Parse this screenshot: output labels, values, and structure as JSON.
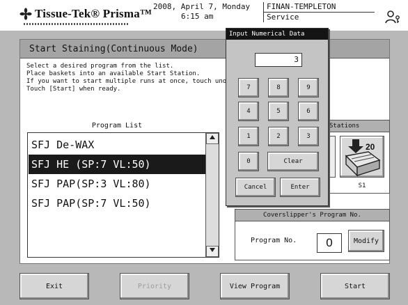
{
  "header": {
    "brand": "Tissue-Tek® Prisma™",
    "date": "2008, April 7, Monday",
    "time": "6:15 am",
    "user": "FINAN-TEMPLETON",
    "role": "Service",
    "icons": {
      "logo": "flower-logo-icon",
      "user": "user-key-icon"
    }
  },
  "screen": {
    "title": "Start Staining(Continuous Mode)",
    "instructions": [
      "Select a desired program from the list.",
      "Place baskets into an available Start Station.",
      "If you want to start multiple runs at once, touch unoccu",
      "Touch [Start] when ready."
    ]
  },
  "program_list": {
    "label": "Program List",
    "items": [
      "SFJ De-WAX",
      "SFJ HE (SP:7  VL:50)",
      "SFJ PAP(SP:3  VL:80)",
      "SFJ PAP(SP:7  VL:50)"
    ],
    "selected_index": 1
  },
  "stations": {
    "header": "Stations",
    "badge": "20",
    "station_label": "S1"
  },
  "coverslipper": {
    "header": "Coverslipper's  Program  No.",
    "label": "Program No.",
    "value": "0",
    "modify": "Modify"
  },
  "bottom_buttons": {
    "exit": "Exit",
    "priority": "Priority",
    "view_program": "View Program",
    "start": "Start"
  },
  "numeric_dialog": {
    "title": "Input Numerical Data",
    "value": "3",
    "keys": [
      "7",
      "8",
      "9",
      "4",
      "5",
      "6",
      "1",
      "2",
      "3",
      "0",
      "Clear",
      "Cancel",
      "Enter"
    ]
  },
  "colors": {
    "selection": "#1a1a1a",
    "title_bar": "#a4a4a4",
    "background": "#b8b8b8"
  }
}
